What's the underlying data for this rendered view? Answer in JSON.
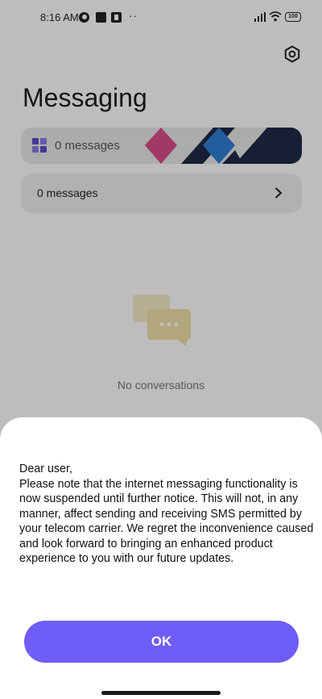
{
  "status_bar": {
    "time": "8:16 AM",
    "more_indicator": "··",
    "battery_level": "100",
    "icons": [
      "notification-icon",
      "notification-icon",
      "notification-icon",
      "signal-icon",
      "wifi-icon",
      "battery-icon"
    ]
  },
  "header": {
    "title": "Messaging",
    "settings_icon": "gear-icon"
  },
  "cards": {
    "first": {
      "label": "0 messages",
      "icon": "grid-icon"
    },
    "second": {
      "label": "0 messages",
      "icon": "chevron-right-icon"
    }
  },
  "empty_state": {
    "icon": "chat-bubbles-icon",
    "text": "No conversations"
  },
  "dialog": {
    "greeting": "Dear user,",
    "message": "Please note that the internet messaging functionality is now suspended until further notice. This will not, in any manner, affect sending and receiving SMS permitted by your telecom carrier. We regret the inconvenience caused and look forward to bringing an enhanced product experience to you with our future updates.",
    "ok_label": "OK"
  },
  "colors": {
    "accent": "#6e5df6",
    "banner_pink": "#d94d8a",
    "banner_navy": "#1e2a45",
    "banner_blue": "#2f7fd4",
    "empty_icon": "#f3e4b0"
  }
}
